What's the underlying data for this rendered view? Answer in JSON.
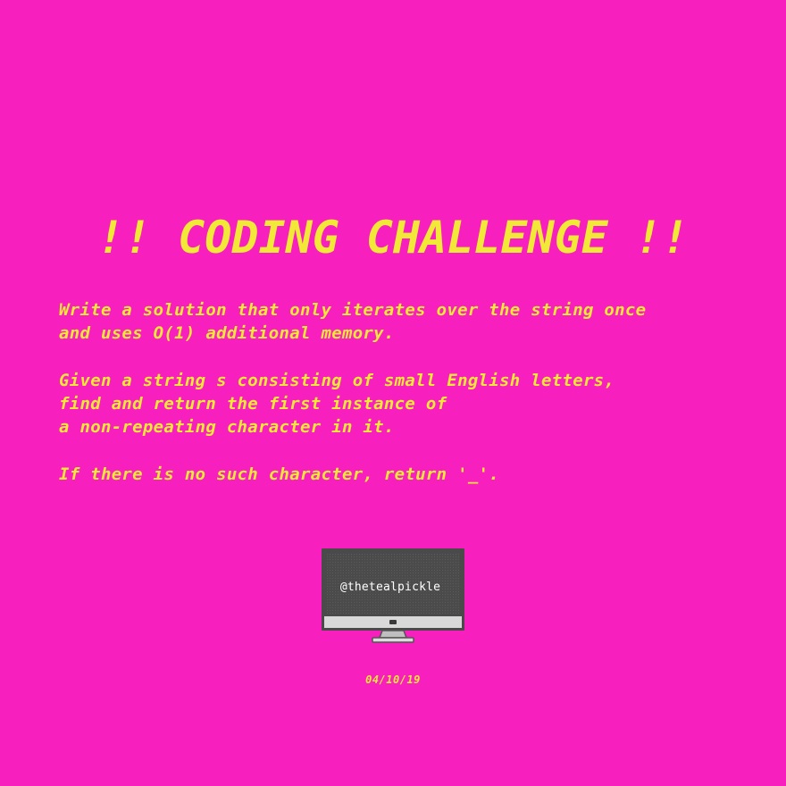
{
  "title": "!! CODING CHALLENGE !!",
  "paragraphs": [
    {
      "lines": [
        "Write a solution that only iterates over the string once",
        "and uses O(1) additional memory."
      ]
    },
    {
      "lines": [
        "Given a string s consisting of small English letters,",
        "find and return the first instance of",
        "a non-repeating character in it."
      ]
    },
    {
      "lines": [
        "If there is no such character, return '_'."
      ]
    }
  ],
  "monitor": {
    "handle": "@thetealpickle",
    "icon": "desktop-computer-icon"
  },
  "date": "04/10/19",
  "colors": {
    "background": "#f71fbd",
    "accent_text": "#f2e838",
    "screen": "#4d4d4d",
    "bezel": "#555555",
    "chin": "#d9d9d9",
    "stand": "#cfcfcf"
  }
}
